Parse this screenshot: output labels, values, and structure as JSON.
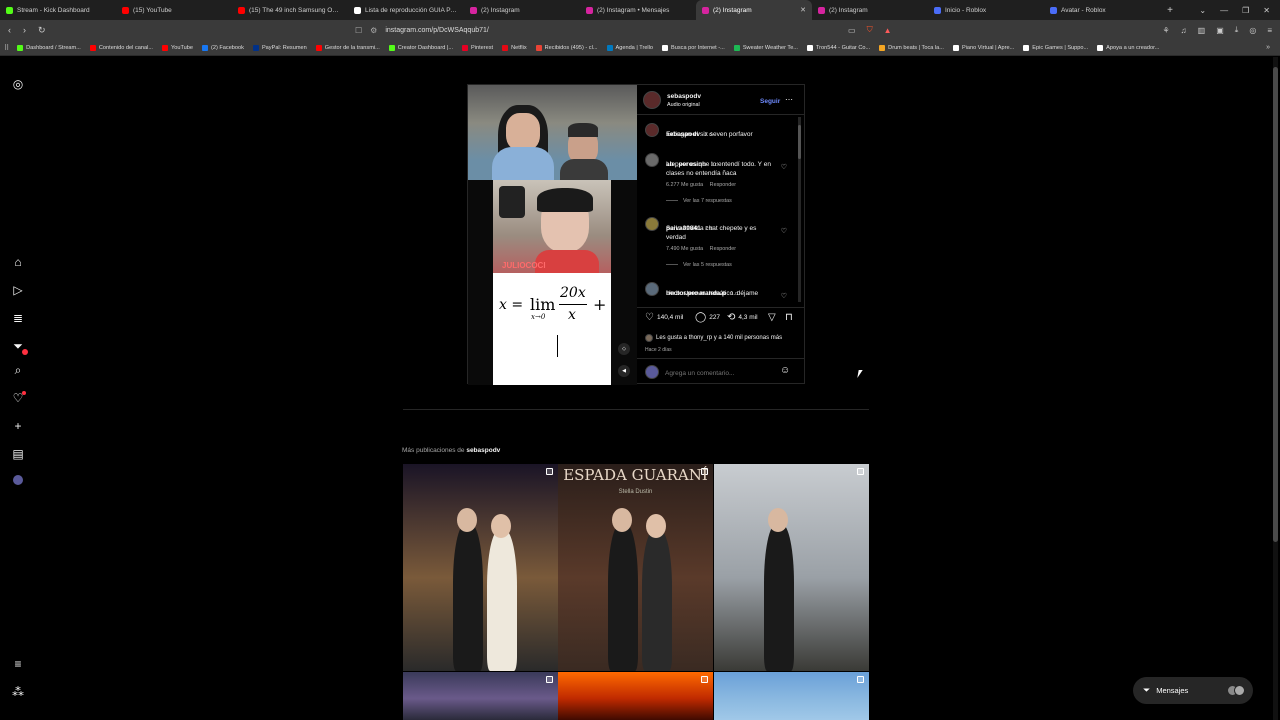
{
  "browser": {
    "tabs": [
      {
        "title": "Stream - Kick Dashboard",
        "color": "#53fc18"
      },
      {
        "title": "(15) YouTube",
        "color": "#ff0000"
      },
      {
        "title": "(15) The 49 inch Samsung Odyssey",
        "color": "#ff0000"
      },
      {
        "title": "Lista de reproducción GUIA PARA",
        "color": "#ffffff"
      },
      {
        "title": "(2) Instagram",
        "color": "#d6249f"
      },
      {
        "title": "(2) Instagram • Mensajes",
        "color": "#d6249f"
      },
      {
        "title": "(2) Instagram",
        "color": "#d6249f",
        "active": true
      },
      {
        "title": "(2) Instagram",
        "color": "#d6249f"
      },
      {
        "title": "Inicio - Roblox",
        "color": "#4a6cf7"
      },
      {
        "title": "Avatar - Roblox",
        "color": "#4a6cf7"
      }
    ],
    "new_tab": "+",
    "url": "instagram.com/p/DcWSAqqub71/",
    "bookmarks": [
      {
        "label": "Dashboard / Stream...",
        "color": "#53fc18"
      },
      {
        "label": "Contenido del canal...",
        "color": "#ff0000"
      },
      {
        "label": "YouTube",
        "color": "#ff0000"
      },
      {
        "label": "(2) Facebook",
        "color": "#1877f2"
      },
      {
        "label": "PayPal: Resumen",
        "color": "#003087"
      },
      {
        "label": "Gestor de la transmi...",
        "color": "#ff0000"
      },
      {
        "label": "Creator Dashboard |...",
        "color": "#53fc18"
      },
      {
        "label": "Pinterest",
        "color": "#e60023"
      },
      {
        "label": "Netflix",
        "color": "#e50914"
      },
      {
        "label": "Recibidos (495) - cl...",
        "color": "#ea4335"
      },
      {
        "label": "Agenda | Trello",
        "color": "#0079bf"
      },
      {
        "label": "Busca por Internet -...",
        "color": "#ffffff"
      },
      {
        "label": "Sweater Weather Te...",
        "color": "#1db954"
      },
      {
        "label": "Tron544 - Guitar Co...",
        "color": "#ffffff"
      },
      {
        "label": "Drum beats | Toca la...",
        "color": "#f5a623"
      },
      {
        "label": "Piano Virtual | Apre...",
        "color": "#ffffff"
      },
      {
        "label": "Epic Games | Suppo...",
        "color": "#ffffff"
      },
      {
        "label": "Apoya a un creador...",
        "color": "#ffffff"
      }
    ]
  },
  "post": {
    "username": "sebaspodv",
    "audio": "Audio original",
    "follow_label": "Seguir",
    "more_icon": "⋯",
    "watermark": "JULIOCOCI",
    "formula_lhs": "x =",
    "formula_lim": "lim",
    "formula_sub": "x→0",
    "formula_num": "20x",
    "formula_den": "x",
    "formula_plus": "+",
    "caption": {
      "user": "sebaspodv",
      "time": "2 d",
      "text": "Extingan el six seven porfavor"
    },
    "comments": [
      {
        "user": "ale_perosinh",
        "time": "1 d",
        "text": "Lo peor es que lo entendí todo. Y en clases no entendía ñaca",
        "likes": "6.277 Me gusta",
        "reply": "Responder",
        "view_replies": "Ver las 7 respuestas"
      },
      {
        "user": "paiva39841",
        "time": "2 d",
        "text": "Se lo envie a chat chepete y es verdad",
        "likes": "7.490 Me gusta",
        "reply": "Responder",
        "view_replies": "Ver las 5 respuestas"
      },
      {
        "user": "hector.penaranda.p",
        "time": "1 d",
        "text": "Un bostero matemático. déjame"
      }
    ],
    "likes_count": "140,4 mil",
    "comments_count": "227",
    "shares_count": "4,3 mil",
    "liked_by": "Les gusta a thony_rp y a 140 mil personas más",
    "posted": "Hace 2 días",
    "add_comment_placeholder": "Agrega un comentario..."
  },
  "more_posts": {
    "label": "Más publicaciones de",
    "user": "sebaspodv"
  },
  "grid": [
    {
      "top": "#1a1426",
      "mid": "#7a5a3a",
      "bottom": "#2a2a2a"
    },
    {
      "top": "#2a1e1a",
      "mid": "#5a3a2a",
      "bottom": "#3a2a22",
      "overlay": "ESPADA GUARANÍ",
      "overlay_sub": "Stella Dustin"
    },
    {
      "top": "#c8ccd0",
      "mid": "#9aa0a6",
      "bottom": "#3a3a36"
    },
    {
      "top": "#3a3a5a",
      "mid": "#6a5a8a",
      "bottom": "#2a2a3a"
    },
    {
      "top": "#ff6a00",
      "mid": "#c02a00",
      "bottom": "#400a00"
    },
    {
      "top": "#6aa0d8",
      "mid": "#8ab8e0",
      "bottom": "#a0c8e8"
    }
  ],
  "messages": {
    "label": "Mensajes"
  },
  "colors": {
    "accent": "#6f8bff",
    "bg": "#000000",
    "border": "#262626",
    "muted": "#a8a8a8"
  }
}
